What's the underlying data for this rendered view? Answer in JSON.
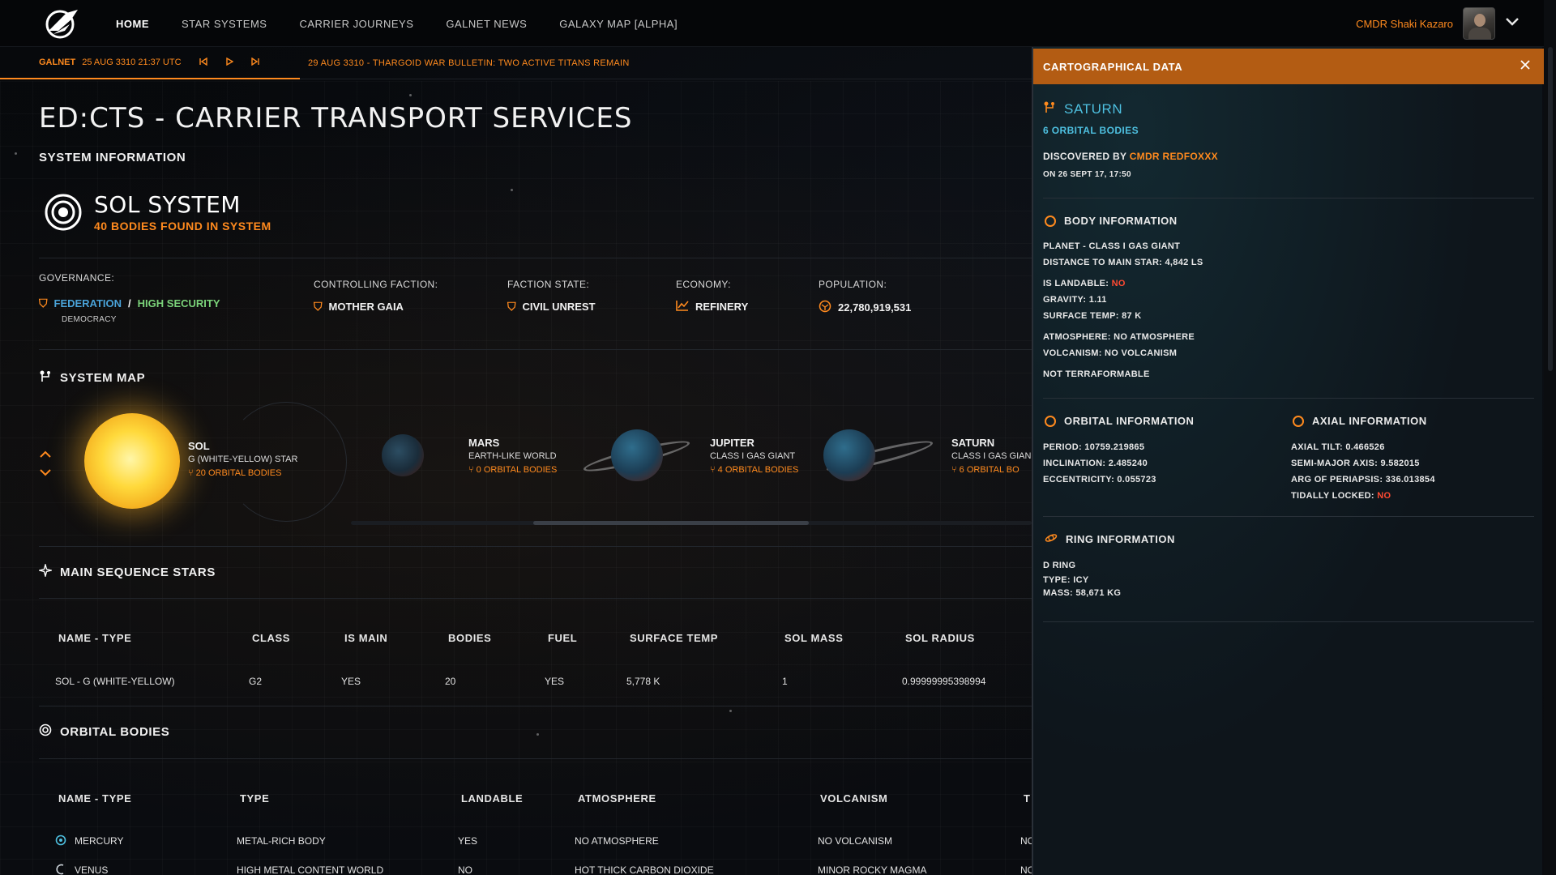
{
  "nav": {
    "items": [
      {
        "label": "HOME",
        "active": true
      },
      {
        "label": "STAR SYSTEMS",
        "active": false
      },
      {
        "label": "CARRIER JOURNEYS",
        "active": false
      },
      {
        "label": "GALNET NEWS",
        "active": false
      },
      {
        "label": "GALAXY MAP [ALPHA]",
        "active": false
      }
    ],
    "user_name": "CMDR Shaki Kazaro"
  },
  "ticker": {
    "label": "GALNET",
    "date": "25 AUG 3310 21:37 UTC",
    "message": "29 AUG 3310 - THARGOID WAR BULLETIN: TWO ACTIVE TITANS REMAIN"
  },
  "page": {
    "title": "ED:CTS - CARRIER TRANSPORT SERVICES",
    "system_info_label": "SYSTEM INFORMATION"
  },
  "system": {
    "name": "SOL SYSTEM",
    "bodies_found": "40 BODIES FOUND IN SYSTEM"
  },
  "stats": {
    "governance_label": "GOVERNANCE:",
    "federation": "FEDERATION",
    "separator": "/",
    "security": "HIGH SECURITY",
    "government": "DEMOCRACY",
    "faction_label": "CONTROLLING FACTION:",
    "faction": "MOTHER GAIA",
    "state_label": "FACTION STATE:",
    "state": "CIVIL UNREST",
    "economy_label": "ECONOMY:",
    "economy": "REFINERY",
    "population_label": "POPULATION:",
    "population": "22,780,919,531"
  },
  "system_map": {
    "label": "SYSTEM MAP",
    "bodies": [
      {
        "name": "SOL",
        "type": "G (WHITE-YELLOW) STAR",
        "count": "20 ORBITAL BODIES"
      },
      {
        "name": "MARS",
        "type": "EARTH-LIKE WORLD",
        "count": "0 ORBITAL BODIES"
      },
      {
        "name": "JUPITER",
        "type": "CLASS I GAS GIANT",
        "count": "4 ORBITAL BODIES"
      },
      {
        "name": "SATURN",
        "type": "CLASS I GAS GIAN",
        "count": "6 ORBITAL BO"
      }
    ]
  },
  "main_sequence": {
    "label": "MAIN SEQUENCE STARS",
    "headers": [
      "NAME - TYPE",
      "CLASS",
      "IS MAIN",
      "BODIES",
      "FUEL",
      "SURFACE TEMP",
      "SOL MASS",
      "SOL RADIUS"
    ],
    "rows": [
      [
        "SOL - G (WHITE-YELLOW)",
        "G2",
        "YES",
        "20",
        "YES",
        "5,778 K",
        "1",
        "0.99999995398994"
      ]
    ]
  },
  "orbital_bodies": {
    "label": "ORBITAL BODIES",
    "headers": [
      "NAME - TYPE",
      "TYPE",
      "LANDABLE",
      "ATMOSPHERE",
      "VOLCANISM",
      "T"
    ],
    "rows": [
      [
        "MERCURY",
        "METAL-RICH BODY",
        "YES",
        "NO ATMOSPHERE",
        "NO VOLCANISM",
        "NO"
      ],
      [
        "VENUS",
        "HIGH METAL CONTENT WORLD",
        "NO",
        "HOT THICK CARBON DIOXIDE",
        "MINOR ROCKY MAGMA",
        "NO"
      ]
    ]
  },
  "panel": {
    "header": "CARTOGRAPHICAL DATA",
    "body_name": "SATURN",
    "orbital_bodies": "6 ORBITAL BODIES",
    "discovered_by_label": "DISCOVERED BY",
    "discoverer": "CMDR REDFOXXX",
    "discovered_on": "ON 26 SEPT 17, 17:50",
    "body_info": {
      "label": "BODY INFORMATION",
      "planet_type": "PLANET  -  CLASS I GAS GIANT",
      "distance_label": "DISTANCE TO MAIN STAR:",
      "distance": "4,842 LS",
      "landable_label": "IS LANDABLE:",
      "landable": "NO",
      "gravity_label": "GRAVITY:",
      "gravity": "1.11",
      "surface_temp_label": "SURFACE TEMP:",
      "surface_temp": "87 K",
      "atmosphere_label": "ATMOSPHERE:",
      "atmosphere": "NO ATMOSPHERE",
      "volcanism_label": "VOLCANISM:",
      "volcanism": "NO VOLCANISM",
      "terraform": "NOT TERRAFORMABLE"
    },
    "orbital_info": {
      "label": "ORBITAL INFORMATION",
      "period_label": "PERIOD:",
      "period": "10759.219865",
      "inclination_label": "INCLINATION:",
      "inclination": "2.485240",
      "eccentricity_label": "ECCENTRICITY:",
      "eccentricity": "0.055723"
    },
    "axial_info": {
      "label": "AXIAL INFORMATION",
      "tilt_label": "AXIAL TILT:",
      "tilt": "0.466526",
      "sma_label": "SEMI-MAJOR AXIS:",
      "sma": "9.582015",
      "periapsis_label": "ARG OF PERIAPSIS:",
      "periapsis": "336.013854",
      "tidal_label": "TIDALLY LOCKED:",
      "tidal": "NO"
    },
    "ring_info": {
      "label": "RING INFORMATION",
      "ring_name": "D RING",
      "type_label": "TYPE:",
      "type": "ICY",
      "mass_label": "MASS:",
      "mass": "58,671 KG"
    }
  },
  "colors": {
    "accent": "#ff8a1e",
    "federation": "#4aa3d9",
    "positive": "#7bd37a",
    "negative": "#ff4a32",
    "panel_header": "#b35c13"
  }
}
